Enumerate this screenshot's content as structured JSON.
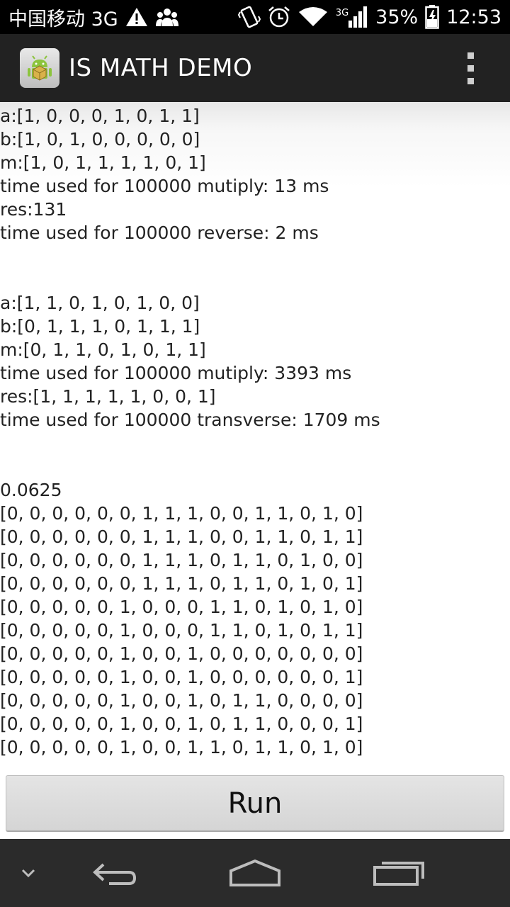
{
  "status_bar": {
    "carrier": "中国移动 3G",
    "battery": "35%",
    "time": "12:53",
    "network": "3G",
    "icons": [
      "warning-icon",
      "people-icon",
      "vibrate-icon",
      "alarm-icon",
      "wifi-icon",
      "signal-icon",
      "battery-charging-icon"
    ]
  },
  "action_bar": {
    "title": "IS MATH DEMO",
    "app_icon": "android-app-icon",
    "menu_icon": "overflow-menu-icon"
  },
  "output_lines": [
    "a:[1, 0, 0, 0, 1, 0, 1, 1]",
    "b:[1, 0, 1, 0, 0, 0, 0, 0]",
    "m:[1, 0, 1, 1, 1, 1, 0, 1]",
    "time used for 100000 mutiply: 13 ms",
    "res:131",
    "time used for 100000 reverse: 2 ms",
    "",
    "",
    "a:[1, 1, 0, 1, 0, 1, 0, 0]",
    "b:[0, 1, 1, 1, 0, 1, 1, 1]",
    "m:[0, 1, 1, 0, 1, 0, 1, 1]",
    "time used for 100000 mutiply: 3393 ms",
    "res:[1, 1, 1, 1, 1, 0, 0, 1]",
    "time used for 100000 transverse: 1709 ms",
    "",
    "",
    "0.0625",
    "[0, 0, 0, 0, 0, 0, 1, 1, 1, 0, 0, 1, 1, 0, 1, 0]",
    "[0, 0, 0, 0, 0, 0, 1, 1, 1, 0, 0, 1, 1, 0, 1, 1]",
    "[0, 0, 0, 0, 0, 0, 1, 1, 1, 0, 1, 1, 0, 1, 0, 0]",
    "[0, 0, 0, 0, 0, 0, 1, 1, 1, 0, 1, 1, 0, 1, 0, 1]",
    "[0, 0, 0, 0, 0, 1, 0, 0, 0, 1, 1, 0, 1, 0, 1, 0]",
    "[0, 0, 0, 0, 0, 1, 0, 0, 0, 1, 1, 0, 1, 0, 1, 1]",
    "[0, 0, 0, 0, 0, 1, 0, 0, 1, 0, 0, 0, 0, 0, 0, 0]",
    "[0, 0, 0, 0, 0, 1, 0, 0, 1, 0, 0, 0, 0, 0, 0, 1]",
    "[0, 0, 0, 0, 0, 1, 0, 0, 1, 0, 1, 1, 0, 0, 0, 0]",
    "[0, 0, 0, 0, 0, 1, 0, 0, 1, 0, 1, 1, 0, 0, 0, 1]",
    "[0, 0, 0, 0, 0, 1, 0, 0, 1, 1, 0, 1, 1, 0, 1, 0]"
  ],
  "run_button": {
    "label": "Run"
  },
  "nav_bar": {
    "items": [
      "chevron-down-icon",
      "back-icon",
      "home-icon",
      "recent-apps-icon"
    ]
  }
}
